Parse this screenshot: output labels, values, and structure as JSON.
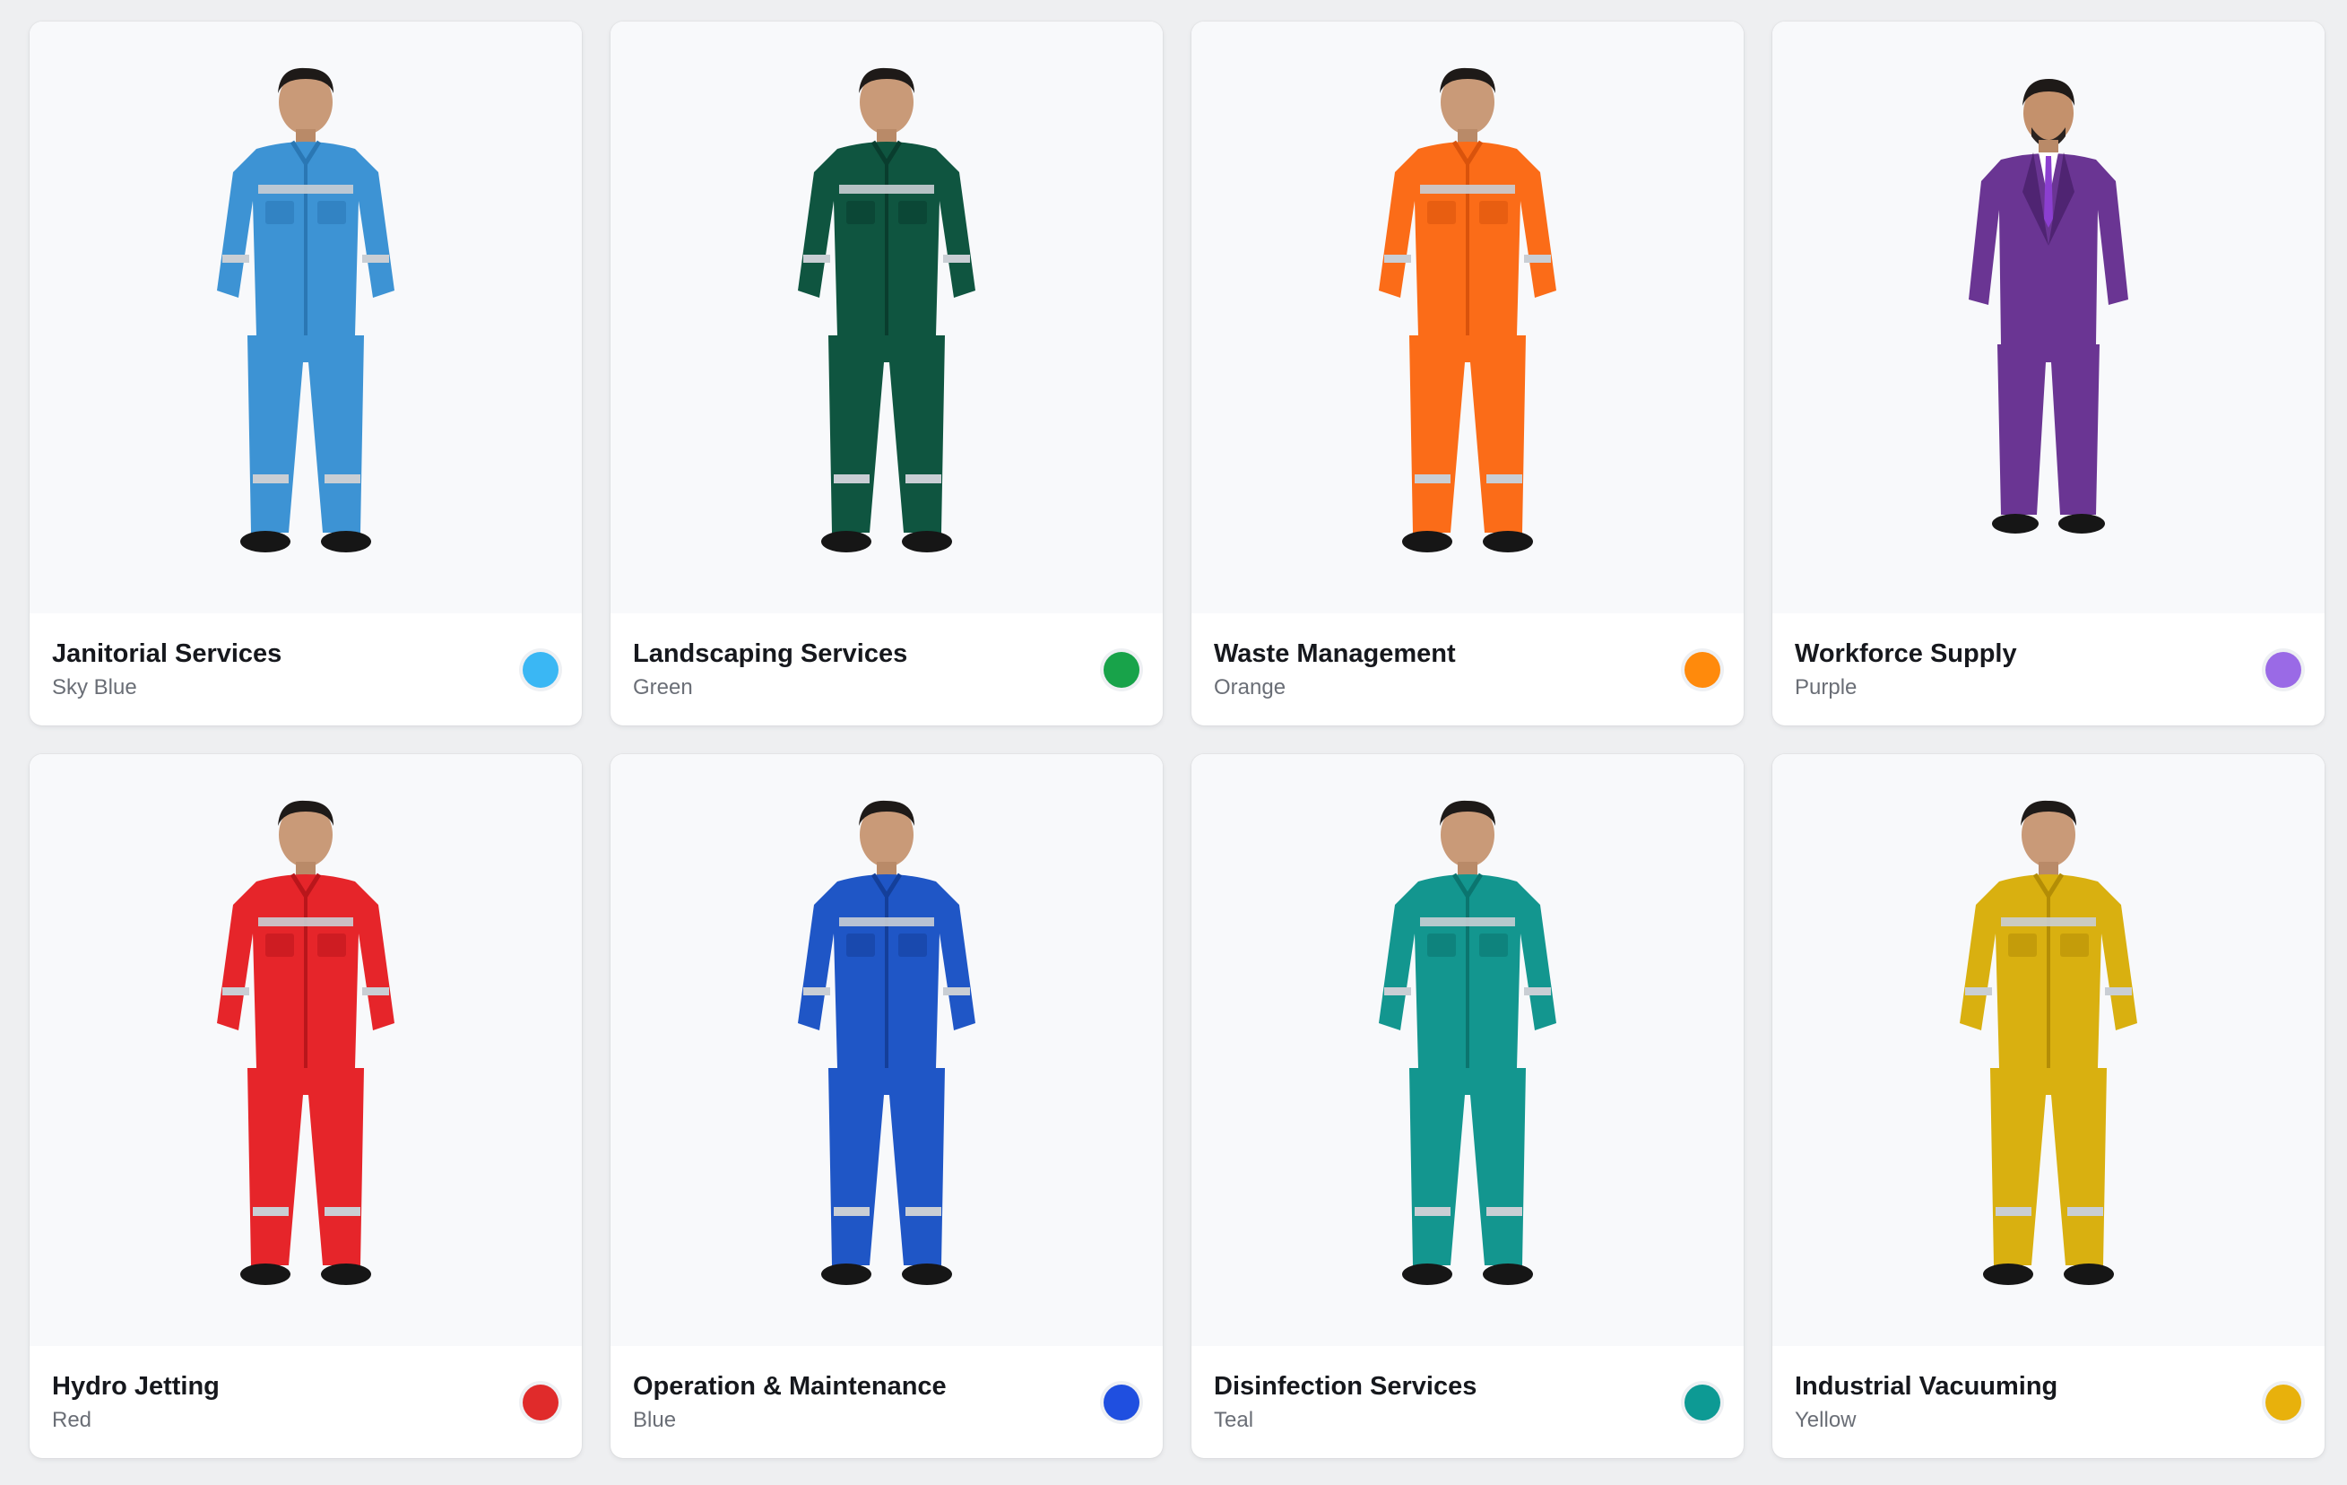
{
  "cards": [
    {
      "title": "Janitorial Services",
      "color_name": "Sky Blue",
      "swatch": "#3ab7f4",
      "suit": "#3d93d4",
      "suit_dark": "#2a77b4",
      "figure": "coverall"
    },
    {
      "title": "Landscaping Services",
      "color_name": "Green",
      "swatch": "#18a34a",
      "suit": "#0f5540",
      "suit_dark": "#093d2e",
      "figure": "coverall"
    },
    {
      "title": "Waste Management",
      "color_name": "Orange",
      "swatch": "#ff8a0c",
      "suit": "#fb6c18",
      "suit_dark": "#d9530c",
      "figure": "coverall"
    },
    {
      "title": "Workforce Supply",
      "color_name": "Purple",
      "swatch": "#9a6ae6",
      "suit": "#6a3593",
      "suit_dark": "#4f2472",
      "figure": "suit"
    },
    {
      "title": "Hydro Jetting",
      "color_name": "Red",
      "swatch": "#e02b2b",
      "suit": "#e6252a",
      "suit_dark": "#b9161b",
      "figure": "coverall"
    },
    {
      "title": "Operation & Maintenance",
      "color_name": "Blue",
      "swatch": "#1f4fe0",
      "suit": "#1f56c6",
      "suit_dark": "#143f9a",
      "figure": "coverall"
    },
    {
      "title": "Disinfection Services",
      "color_name": "Teal",
      "swatch": "#0d9a94",
      "suit": "#13968f",
      "suit_dark": "#0b756f",
      "figure": "coverall"
    },
    {
      "title": "Industrial Vacuuming",
      "color_name": "Yellow",
      "swatch": "#e8b10c",
      "suit": "#d9b010",
      "suit_dark": "#b38d06",
      "figure": "coverall"
    }
  ]
}
